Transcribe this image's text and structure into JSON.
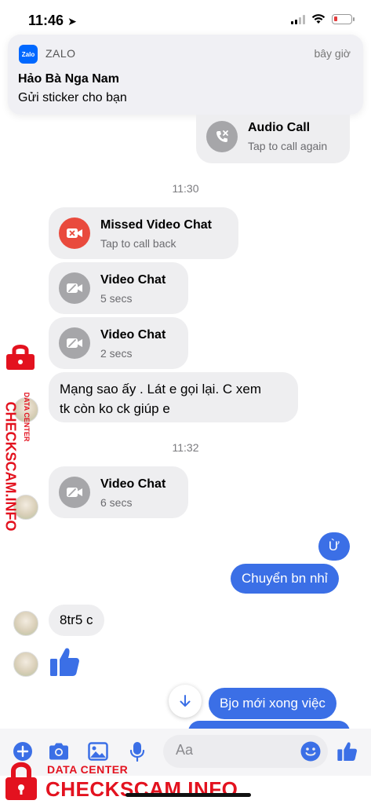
{
  "status_bar": {
    "time": "11:46"
  },
  "notification": {
    "app": "ZALO",
    "logo_text": "Zalo",
    "time": "bây giờ",
    "title": "Hảo Bà Nga Nam",
    "body": "Gửi sticker cho bạn"
  },
  "messages": {
    "audio_call": {
      "title": "Audio Call",
      "subtitle": "Tap to call again"
    },
    "timestamp_1": "11:30",
    "missed_video": {
      "title": "Missed Video Chat",
      "subtitle": "Tap to call back"
    },
    "video_1": {
      "title": "Video Chat",
      "subtitle": "5 secs"
    },
    "video_2": {
      "title": "Video Chat",
      "subtitle": "2 secs"
    },
    "text_1_line1": "Mạng sao ấy . Lát e gọi lại. C xem",
    "text_1_line2": "tk còn ko ck giúp e",
    "timestamp_2": "11:32",
    "video_3": {
      "title": "Video Chat",
      "subtitle": "6 secs"
    },
    "sent_1": "Ừ",
    "sent_2": "Chuyển bn nhỉ",
    "received_1": "8tr5 c",
    "sent_3": "Bjo mới xong việc"
  },
  "composer": {
    "placeholder": "Aa"
  },
  "watermark": {
    "sub": "DATA CENTER",
    "main": "CHECKSCAM.INFO"
  },
  "colors": {
    "sent_bubble": "#3b6fe6",
    "received_bubble": "#eeeef0",
    "missed_call": "#e94a3d",
    "accent": "#3b6fe6",
    "watermark": "#e3121f"
  }
}
